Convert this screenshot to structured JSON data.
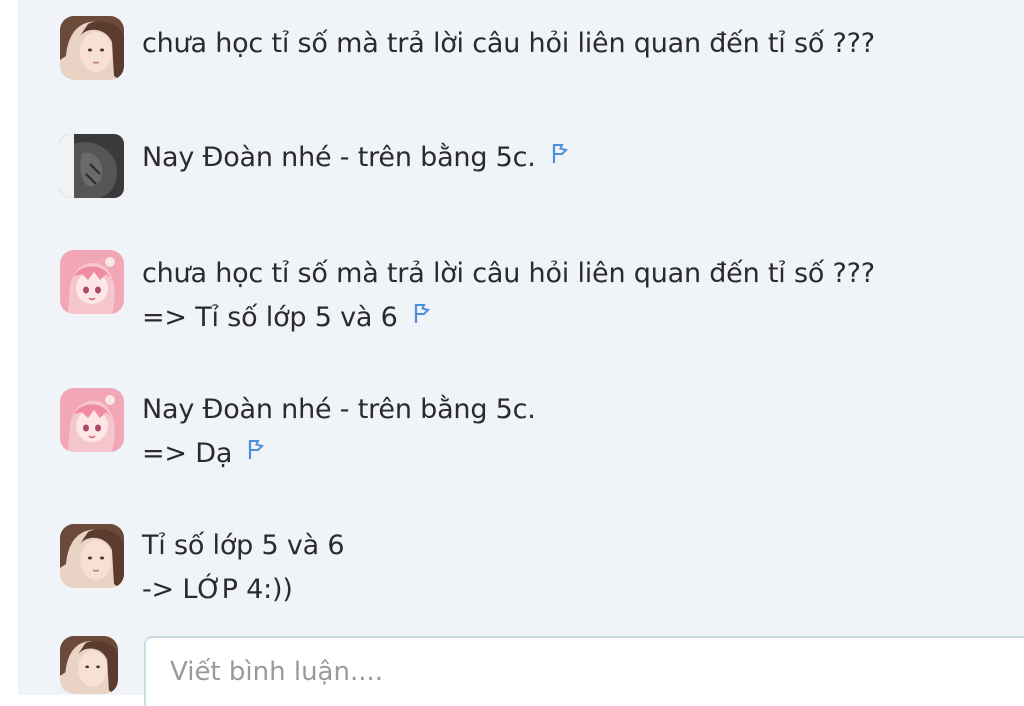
{
  "comments": [
    {
      "avatar_icon": "girl-avatar-icon",
      "lines": [
        "chưa học tỉ số mà trả lời câu hỏi liên quan đến tỉ số ???"
      ],
      "flag": false
    },
    {
      "avatar_icon": "dark-avatar-icon",
      "lines": [
        "Nay Đoàn nhé - trên bằng 5c."
      ],
      "flag": true
    },
    {
      "avatar_icon": "anime-pink-avatar-icon",
      "lines": [
        "chưa học tỉ số mà trả lời câu hỏi liên quan đến tỉ số ???",
        "=> Tỉ số lớp 5 và 6"
      ],
      "flag": true
    },
    {
      "avatar_icon": "anime-pink-avatar-icon",
      "lines": [
        "Nay Đoàn nhé - trên bằng 5c.",
        "=> Dạ"
      ],
      "flag": true
    },
    {
      "avatar_icon": "girl-avatar-icon",
      "lines": [
        "Tỉ số lớp 5 và 6",
        "-> LỚP 4:))"
      ],
      "flag": false
    }
  ],
  "composer": {
    "placeholder": "Viết bình luận....",
    "value": ""
  },
  "colors": {
    "background": "#f0f3f8",
    "flag": "#4a90d9",
    "text": "#2b2b2b",
    "input_border": "#c8dce6"
  }
}
